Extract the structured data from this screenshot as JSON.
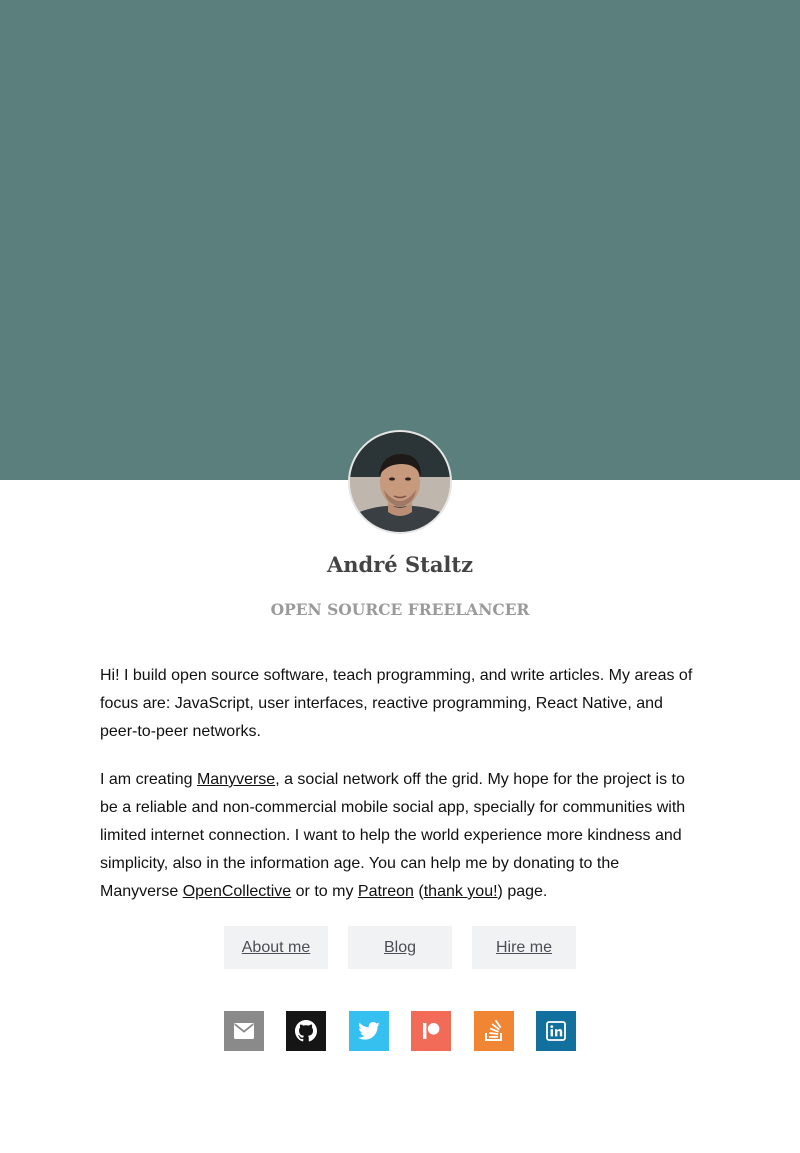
{
  "profile": {
    "name": "André Staltz",
    "tagline": "OPEN SOURCE FREELANCER",
    "avatar_alt": "André Staltz"
  },
  "bio": {
    "p1": "Hi! I build open source software, teach programming, and write articles. My areas of focus are: JavaScript, user interfaces, reactive programming, React Native, and peer-to-peer networks.",
    "p2_part1": "I am creating ",
    "p2_link_manyverse": "Manyverse",
    "p2_part2": ", a social network off the grid. My hope for the project is to be a reliable and non-commercial mobile social app, specially for communities with limited internet connection. I want to help the world experience more kindness and simplicity, also in the information age. You can help me by donating to the Manyverse ",
    "p2_link_opencollective": "OpenCollective",
    "p2_part3": " or to my ",
    "p2_link_patreon": "Patreon",
    "p2_part4": " (",
    "p2_link_thanks": "thank you!",
    "p2_part5": ") page."
  },
  "nav": {
    "about_label": "About me",
    "blog_label": "Blog",
    "hire_label": "Hire me"
  },
  "social": [
    {
      "name": "email",
      "icon": "envelope-icon",
      "color": "#8a8a8a"
    },
    {
      "name": "github",
      "icon": "github-icon",
      "color": "#151515"
    },
    {
      "name": "twitter",
      "icon": "twitter-icon",
      "color": "#35c0f0"
    },
    {
      "name": "patreon",
      "icon": "patreon-icon",
      "color": "#f26a58"
    },
    {
      "name": "stackoverflow",
      "icon": "stackoverflow-icon",
      "color": "#f08533"
    },
    {
      "name": "linkedin",
      "icon": "linkedin-icon",
      "color": "#12709f"
    }
  ],
  "colors": {
    "hero": "#5a7f7c",
    "nav_button_bg": "#f1f2f3"
  }
}
